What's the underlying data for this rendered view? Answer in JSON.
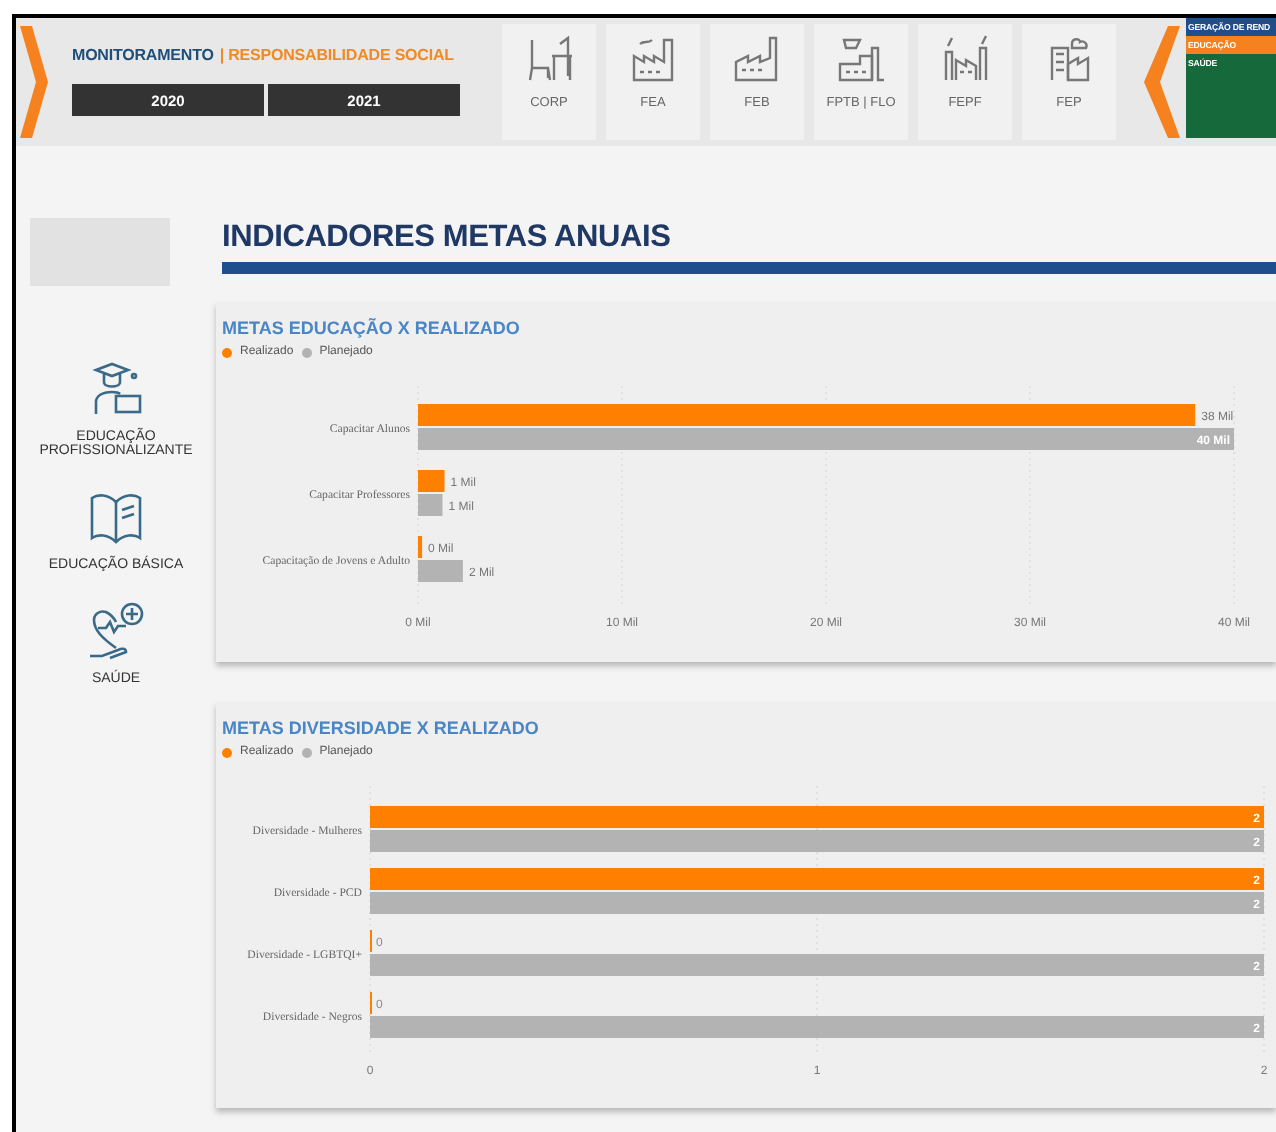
{
  "header": {
    "title": "MONITORAMENTO",
    "subtitle": "| RESPONSABILIDADE SOCIAL",
    "years": [
      "2020",
      "2021"
    ],
    "units": [
      {
        "label": "CORP",
        "kind": "desk"
      },
      {
        "label": "FEA",
        "kind": "factory"
      },
      {
        "label": "FEB",
        "kind": "plant"
      },
      {
        "label": "FPTB | FLO",
        "kind": "mill"
      },
      {
        "label": "FEPF",
        "kind": "smoke"
      },
      {
        "label": "FEP",
        "kind": "tower"
      }
    ]
  },
  "area_menu": [
    {
      "label": "GERAÇÃO DE REND",
      "color": "#1f4e8c"
    },
    {
      "label": "EDUCAÇÃO",
      "color": "#f5821f"
    },
    {
      "label": "SAÚDE",
      "color": "#16693a"
    }
  ],
  "sidebar": {
    "items": [
      {
        "label": "EDUCAÇÃO PROFISSIONALIZANTE",
        "kind": "graduate"
      },
      {
        "label": "EDUCAÇÃO BÁSICA",
        "kind": "book"
      },
      {
        "label": "SAÚDE",
        "kind": "health"
      }
    ]
  },
  "page_title": "INDICADORES METAS ANUAIS",
  "charts": [
    {
      "chart_data": {
        "type": "bar",
        "orientation": "horizontal",
        "title": "METAS EDUCAÇÃO X REALIZADO",
        "categories": [
          "Capacitar Alunos",
          "Capacitar Professores",
          "Capacitação de Jovens e Adulto"
        ],
        "series": [
          {
            "name": "Realizado",
            "color": "#ff8000",
            "values": [
              38.1,
              1.3,
              0.2
            ],
            "value_labels": [
              "38 Mil",
              "1 Mil",
              "0 Mil"
            ]
          },
          {
            "name": "Planejado",
            "color": "#b3b3b3",
            "values": [
              40,
              1.2,
              2.2
            ],
            "value_labels": [
              "40 Mil",
              "1 Mil",
              "2 Mil"
            ]
          }
        ],
        "grid": true,
        "xlim": [
          0,
          40
        ],
        "xticks": [
          {
            "value": 0,
            "label": "0 Mil"
          },
          {
            "value": 10,
            "label": "10 Mil"
          },
          {
            "value": 20,
            "label": "20 Mil"
          },
          {
            "value": 30,
            "label": "30 Mil"
          },
          {
            "value": 40,
            "label": "40 Mil"
          }
        ],
        "data_labels": true
      }
    },
    {
      "chart_data": {
        "type": "bar",
        "orientation": "horizontal",
        "title": "METAS DIVERSIDADE X REALIZADO",
        "categories": [
          "Diversidade - Mulheres",
          "Diversidade - PCD",
          "Diversidade - LGBTQI+",
          "Diversidade - Negros"
        ],
        "series": [
          {
            "name": "Realizado",
            "color": "#ff8000",
            "values": [
              2,
              2,
              0,
              0
            ],
            "value_labels": [
              "2",
              "2",
              "0",
              "0"
            ]
          },
          {
            "name": "Planejado",
            "color": "#b3b3b3",
            "values": [
              2,
              2,
              2,
              2
            ],
            "value_labels": [
              "2",
              "2",
              "2",
              "2"
            ]
          }
        ],
        "grid": true,
        "xlim": [
          0,
          2
        ],
        "xticks": [
          0,
          1,
          2
        ],
        "data_labels": true
      }
    }
  ]
}
